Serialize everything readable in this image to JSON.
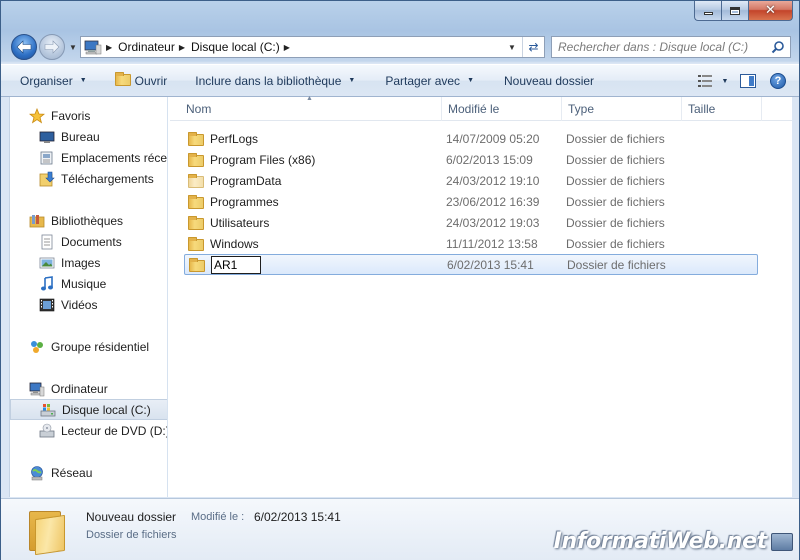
{
  "window": {
    "controls": {
      "minimize": "minimize",
      "maximize": "maximize",
      "close": "close"
    }
  },
  "nav": {
    "back_icon": "back-arrow-icon",
    "forward_icon": "forward-arrow-icon"
  },
  "address": {
    "crumbs": [
      "Ordinateur",
      "Disque local (C:)"
    ],
    "separator": "▶"
  },
  "search": {
    "placeholder": "Rechercher dans : Disque local (C:)"
  },
  "toolbar": {
    "organize": "Organiser",
    "open": "Ouvrir",
    "include": "Inclure dans la bibliothèque",
    "share": "Partager avec",
    "new_folder": "Nouveau dossier",
    "help": "?"
  },
  "sidebar": {
    "favorites": {
      "label": "Favoris",
      "items": [
        "Bureau",
        "Emplacements récents",
        "Téléchargements"
      ]
    },
    "libraries": {
      "label": "Bibliothèques",
      "items": [
        "Documents",
        "Images",
        "Musique",
        "Vidéos"
      ]
    },
    "homegroup": {
      "label": "Groupe résidentiel"
    },
    "computer": {
      "label": "Ordinateur",
      "items": [
        "Disque local (C:)",
        "Lecteur de DVD (D:)"
      ]
    },
    "network": {
      "label": "Réseau"
    }
  },
  "columns": {
    "name": "Nom",
    "modified": "Modifié le",
    "type": "Type",
    "size": "Taille"
  },
  "files": [
    {
      "name": "PerfLogs",
      "modified": "14/07/2009 05:20",
      "type": "Dossier de fichiers"
    },
    {
      "name": "Program Files (x86)",
      "modified": "6/02/2013 15:09",
      "type": "Dossier de fichiers"
    },
    {
      "name": "ProgramData",
      "modified": "24/03/2012 19:10",
      "type": "Dossier de fichiers"
    },
    {
      "name": "Programmes",
      "modified": "23/06/2012 16:39",
      "type": "Dossier de fichiers"
    },
    {
      "name": "Utilisateurs",
      "modified": "24/03/2012 19:03",
      "type": "Dossier de fichiers"
    },
    {
      "name": "Windows",
      "modified": "11/11/2012 13:58",
      "type": "Dossier de fichiers"
    },
    {
      "name": "AR1",
      "modified": "6/02/2013 15:41",
      "type": "Dossier de fichiers"
    }
  ],
  "details": {
    "name": "Nouveau dossier",
    "modified_label": "Modifié le :",
    "modified_value": "6/02/2013 15:41",
    "type": "Dossier de fichiers"
  },
  "watermark": "InformatiWeb.net"
}
